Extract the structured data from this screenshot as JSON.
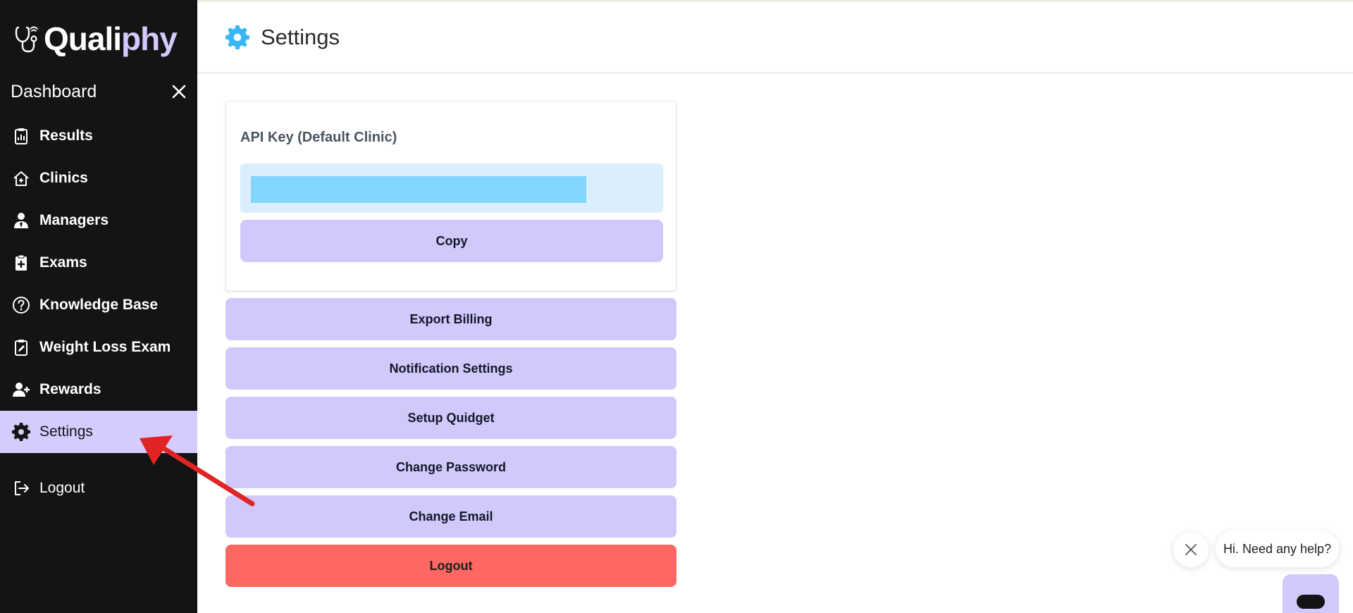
{
  "brand": {
    "name_part1": "Quali",
    "name_part2": "phy"
  },
  "sidebar": {
    "title": "Dashboard",
    "items": [
      {
        "label": "Results",
        "icon": "clipboard-chart-icon"
      },
      {
        "label": "Clinics",
        "icon": "house-plus-icon"
      },
      {
        "label": "Managers",
        "icon": "user-tie-icon"
      },
      {
        "label": "Exams",
        "icon": "clipboard-plus-icon"
      },
      {
        "label": "Knowledge Base",
        "icon": "question-circle-icon"
      },
      {
        "label": "Weight Loss Exam",
        "icon": "clipboard-edit-icon"
      },
      {
        "label": "Rewards",
        "icon": "user-plus-icon"
      },
      {
        "label": "Settings",
        "icon": "gear-icon",
        "active": true
      },
      {
        "label": "Logout",
        "icon": "logout-icon"
      }
    ]
  },
  "header": {
    "title": "Settings",
    "icon": "gear-icon"
  },
  "api_card": {
    "title": "API Key (Default Clinic)",
    "copy_label": "Copy"
  },
  "actions": {
    "export_billing": "Export Billing",
    "notification_settings": "Notification Settings",
    "setup_quidget": "Setup Quidget",
    "change_password": "Change Password",
    "change_email": "Change Email",
    "logout": "Logout"
  },
  "chat": {
    "greeting": "Hi. Need any help?"
  },
  "colors": {
    "sidebar_bg": "#141414",
    "active_item_bg": "#d5cbfd",
    "button_bg": "#d1c8fb",
    "danger_bg": "#fe6762",
    "key_box_bg": "#dbeefe",
    "key_bar": "#82d5fd",
    "header_icon": "#38b6f5",
    "annotation_arrow": "#e02424"
  }
}
